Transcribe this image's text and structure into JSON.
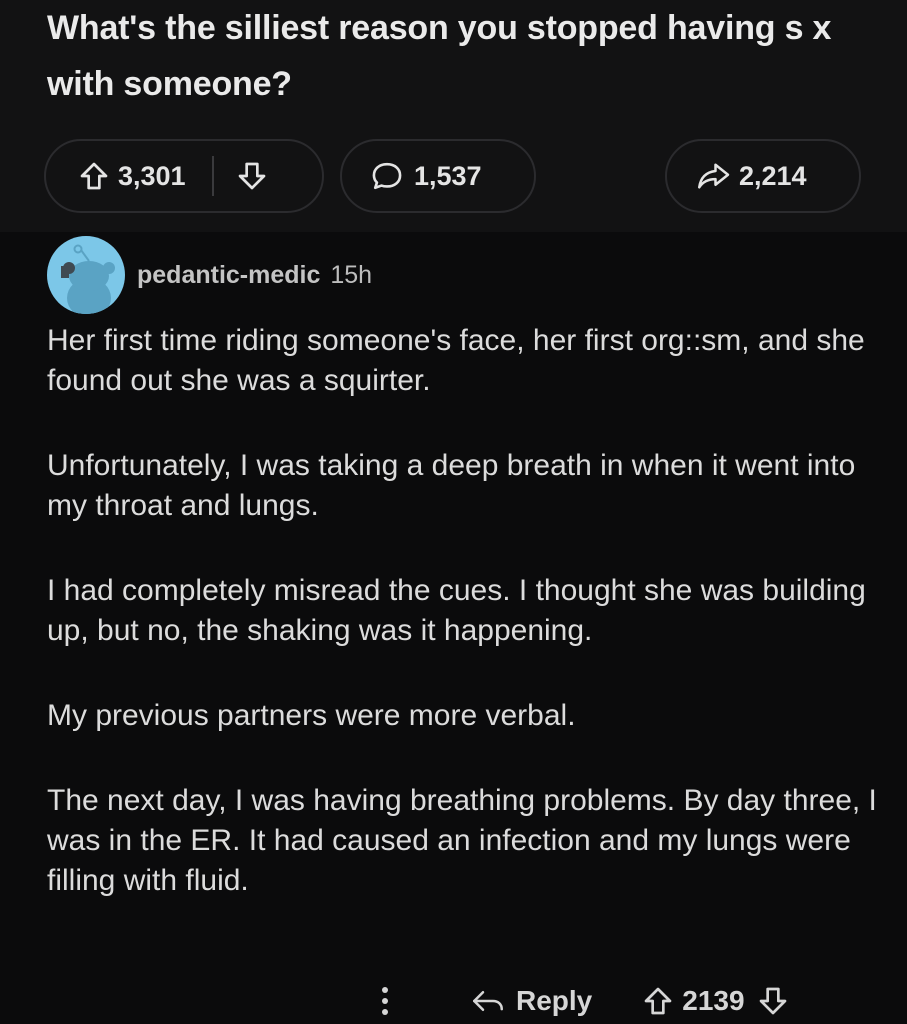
{
  "post": {
    "title": "What's the silliest reason you stopped having s  x with someone?",
    "upvotes": "3,301",
    "comments": "1,537",
    "shares": "2,214"
  },
  "comment": {
    "author": "pedantic-medic",
    "time": "15h",
    "paragraphs": [
      "Her first time riding someone's face, her first org::sm, and she found out she was a squirter.",
      "Unfortunately, I was taking a deep breath in when it went into my throat and lungs.",
      "I had completely misread the cues. I thought she was building up, but no, the shaking was it happening.",
      "My previous partners were more verbal.",
      "The next day, I was having breathing problems. By day three, I was in the ER. It had caused an infection and my lungs were filling with fluid."
    ],
    "reply_label": "Reply",
    "vote_count": "2139"
  },
  "icons": {
    "upvote": "upvote-arrow-icon",
    "downvote": "downvote-arrow-icon",
    "comment": "comment-bubble-icon",
    "share": "share-arrow-icon",
    "more": "more-options-icon",
    "reply": "reply-arrow-icon"
  },
  "colors": {
    "background": "#0b0b0c",
    "header_background": "#121213",
    "avatar": "#7cc7e8",
    "text": "#dcdcdc"
  }
}
